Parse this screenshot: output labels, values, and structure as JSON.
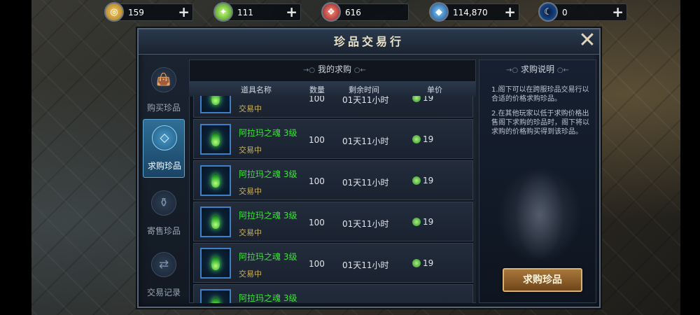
{
  "resources": [
    {
      "icon": "gold-coin-icon",
      "value": "159"
    },
    {
      "icon": "green-crystal-icon",
      "value": "111"
    },
    {
      "icon": "red-gem-icon",
      "value": "616"
    },
    {
      "icon": "blue-diamond-icon",
      "value": "114,870"
    },
    {
      "icon": "blue-orb-icon",
      "value": "0"
    }
  ],
  "panel": {
    "title": "珍品交易行",
    "close_label": "✕"
  },
  "tabs": [
    {
      "label": "购买珍品",
      "icon": "bag-icon",
      "active": false
    },
    {
      "label": "求购珍品",
      "icon": "hand-diamond-icon",
      "active": true
    },
    {
      "label": "寄售珍品",
      "icon": "pouch-icon",
      "active": false
    },
    {
      "label": "交易记录",
      "icon": "exchange-icon",
      "active": false
    }
  ],
  "my_requests": {
    "title": "我的求购",
    "columns": {
      "name": "道具名称",
      "qty": "数量",
      "remaining": "剩余时间",
      "price": "单价"
    },
    "rows": [
      {
        "name": "",
        "status": "交易中",
        "qty": "100",
        "remaining": "01天11小时",
        "price": "19"
      },
      {
        "name": "阿拉玛之魂 3级",
        "status": "交易中",
        "qty": "100",
        "remaining": "01天11小时",
        "price": "19"
      },
      {
        "name": "阿拉玛之魂 3级",
        "status": "交易中",
        "qty": "100",
        "remaining": "01天11小时",
        "price": "19"
      },
      {
        "name": "阿拉玛之魂 3级",
        "status": "交易中",
        "qty": "100",
        "remaining": "01天11小时",
        "price": "19"
      },
      {
        "name": "阿拉玛之魂 3级",
        "status": "交易中",
        "qty": "100",
        "remaining": "01天11小时",
        "price": "19"
      },
      {
        "name": "阿拉玛之魂 3级",
        "status": "",
        "qty": "",
        "remaining": "",
        "price": ""
      }
    ]
  },
  "instructions": {
    "title": "求购说明",
    "items": [
      "1.阁下可以在跨服珍品交易行以合适的价格求购珍品。",
      "2.在其他玩家以低于求购价格出售阁下求购的珍品时，阁下将以求购的价格购买得到该珍品。"
    ]
  },
  "buy_button": "求购珍品"
}
